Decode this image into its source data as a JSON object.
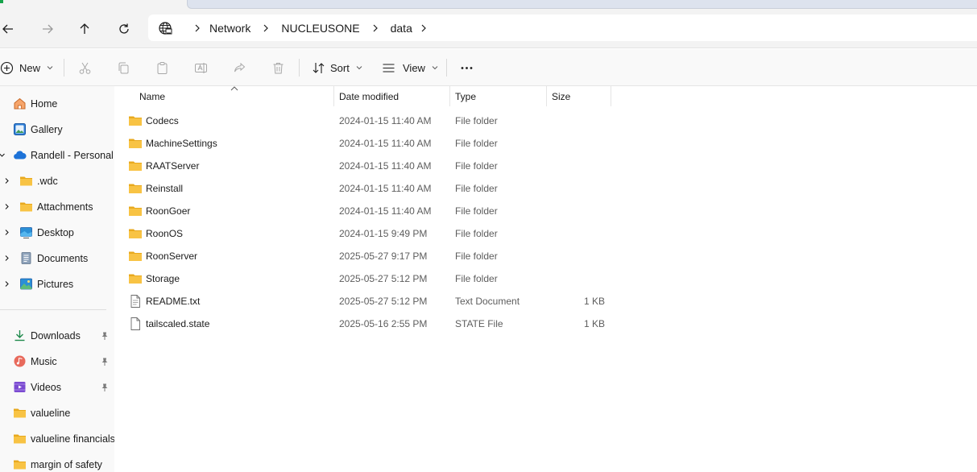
{
  "address": {
    "crumbs": [
      "Network",
      "NUCLEUSONE",
      "data"
    ]
  },
  "commands": {
    "new_label": "New",
    "sort_label": "Sort",
    "view_label": "View"
  },
  "sidebar": {
    "items": [
      {
        "label": "Home",
        "icon": "home-icon"
      },
      {
        "label": "Gallery",
        "icon": "gallery-icon"
      },
      {
        "label": "Randell - Personal",
        "icon": "cloud-icon"
      },
      {
        "label": ".wdc",
        "icon": "folder-icon"
      },
      {
        "label": "Attachments",
        "icon": "folder-icon"
      },
      {
        "label": "Desktop",
        "icon": "desktop-icon"
      },
      {
        "label": "Documents",
        "icon": "documents-icon"
      },
      {
        "label": "Pictures",
        "icon": "pictures-icon"
      },
      {
        "label": "Downloads",
        "icon": "downloads-icon"
      },
      {
        "label": "Music",
        "icon": "music-icon"
      },
      {
        "label": "Videos",
        "icon": "videos-icon"
      },
      {
        "label": "valueline",
        "icon": "folder-icon"
      },
      {
        "label": "valueline financials",
        "icon": "folder-icon"
      },
      {
        "label": "margin of safety",
        "icon": "folder-icon"
      }
    ]
  },
  "columns": {
    "name": "Name",
    "date": "Date modified",
    "type": "Type",
    "size": "Size"
  },
  "files": [
    {
      "name": "Codecs",
      "date": "2024-01-15 11:40 AM",
      "type": "File folder",
      "size": ""
    },
    {
      "name": "MachineSettings",
      "date": "2024-01-15 11:40 AM",
      "type": "File folder",
      "size": ""
    },
    {
      "name": "RAATServer",
      "date": "2024-01-15 11:40 AM",
      "type": "File folder",
      "size": ""
    },
    {
      "name": "Reinstall",
      "date": "2024-01-15 11:40 AM",
      "type": "File folder",
      "size": ""
    },
    {
      "name": "RoonGoer",
      "date": "2024-01-15 11:40 AM",
      "type": "File folder",
      "size": ""
    },
    {
      "name": "RoonOS",
      "date": "2024-01-15 9:49 PM",
      "type": "File folder",
      "size": ""
    },
    {
      "name": "RoonServer",
      "date": "2025-05-27 9:17 PM",
      "type": "File folder",
      "size": ""
    },
    {
      "name": "Storage",
      "date": "2025-05-27 5:12 PM",
      "type": "File folder",
      "size": ""
    },
    {
      "name": "README.txt",
      "date": "2025-05-27 5:12 PM",
      "type": "Text Document",
      "size": "1 KB"
    },
    {
      "name": "tailscaled.state",
      "date": "2025-05-16 2:55 PM",
      "type": "STATE File",
      "size": "1 KB"
    }
  ],
  "colors": {
    "folder": "#f8c344",
    "folder_dark": "#e8a91e",
    "accent": "#0067c0"
  }
}
